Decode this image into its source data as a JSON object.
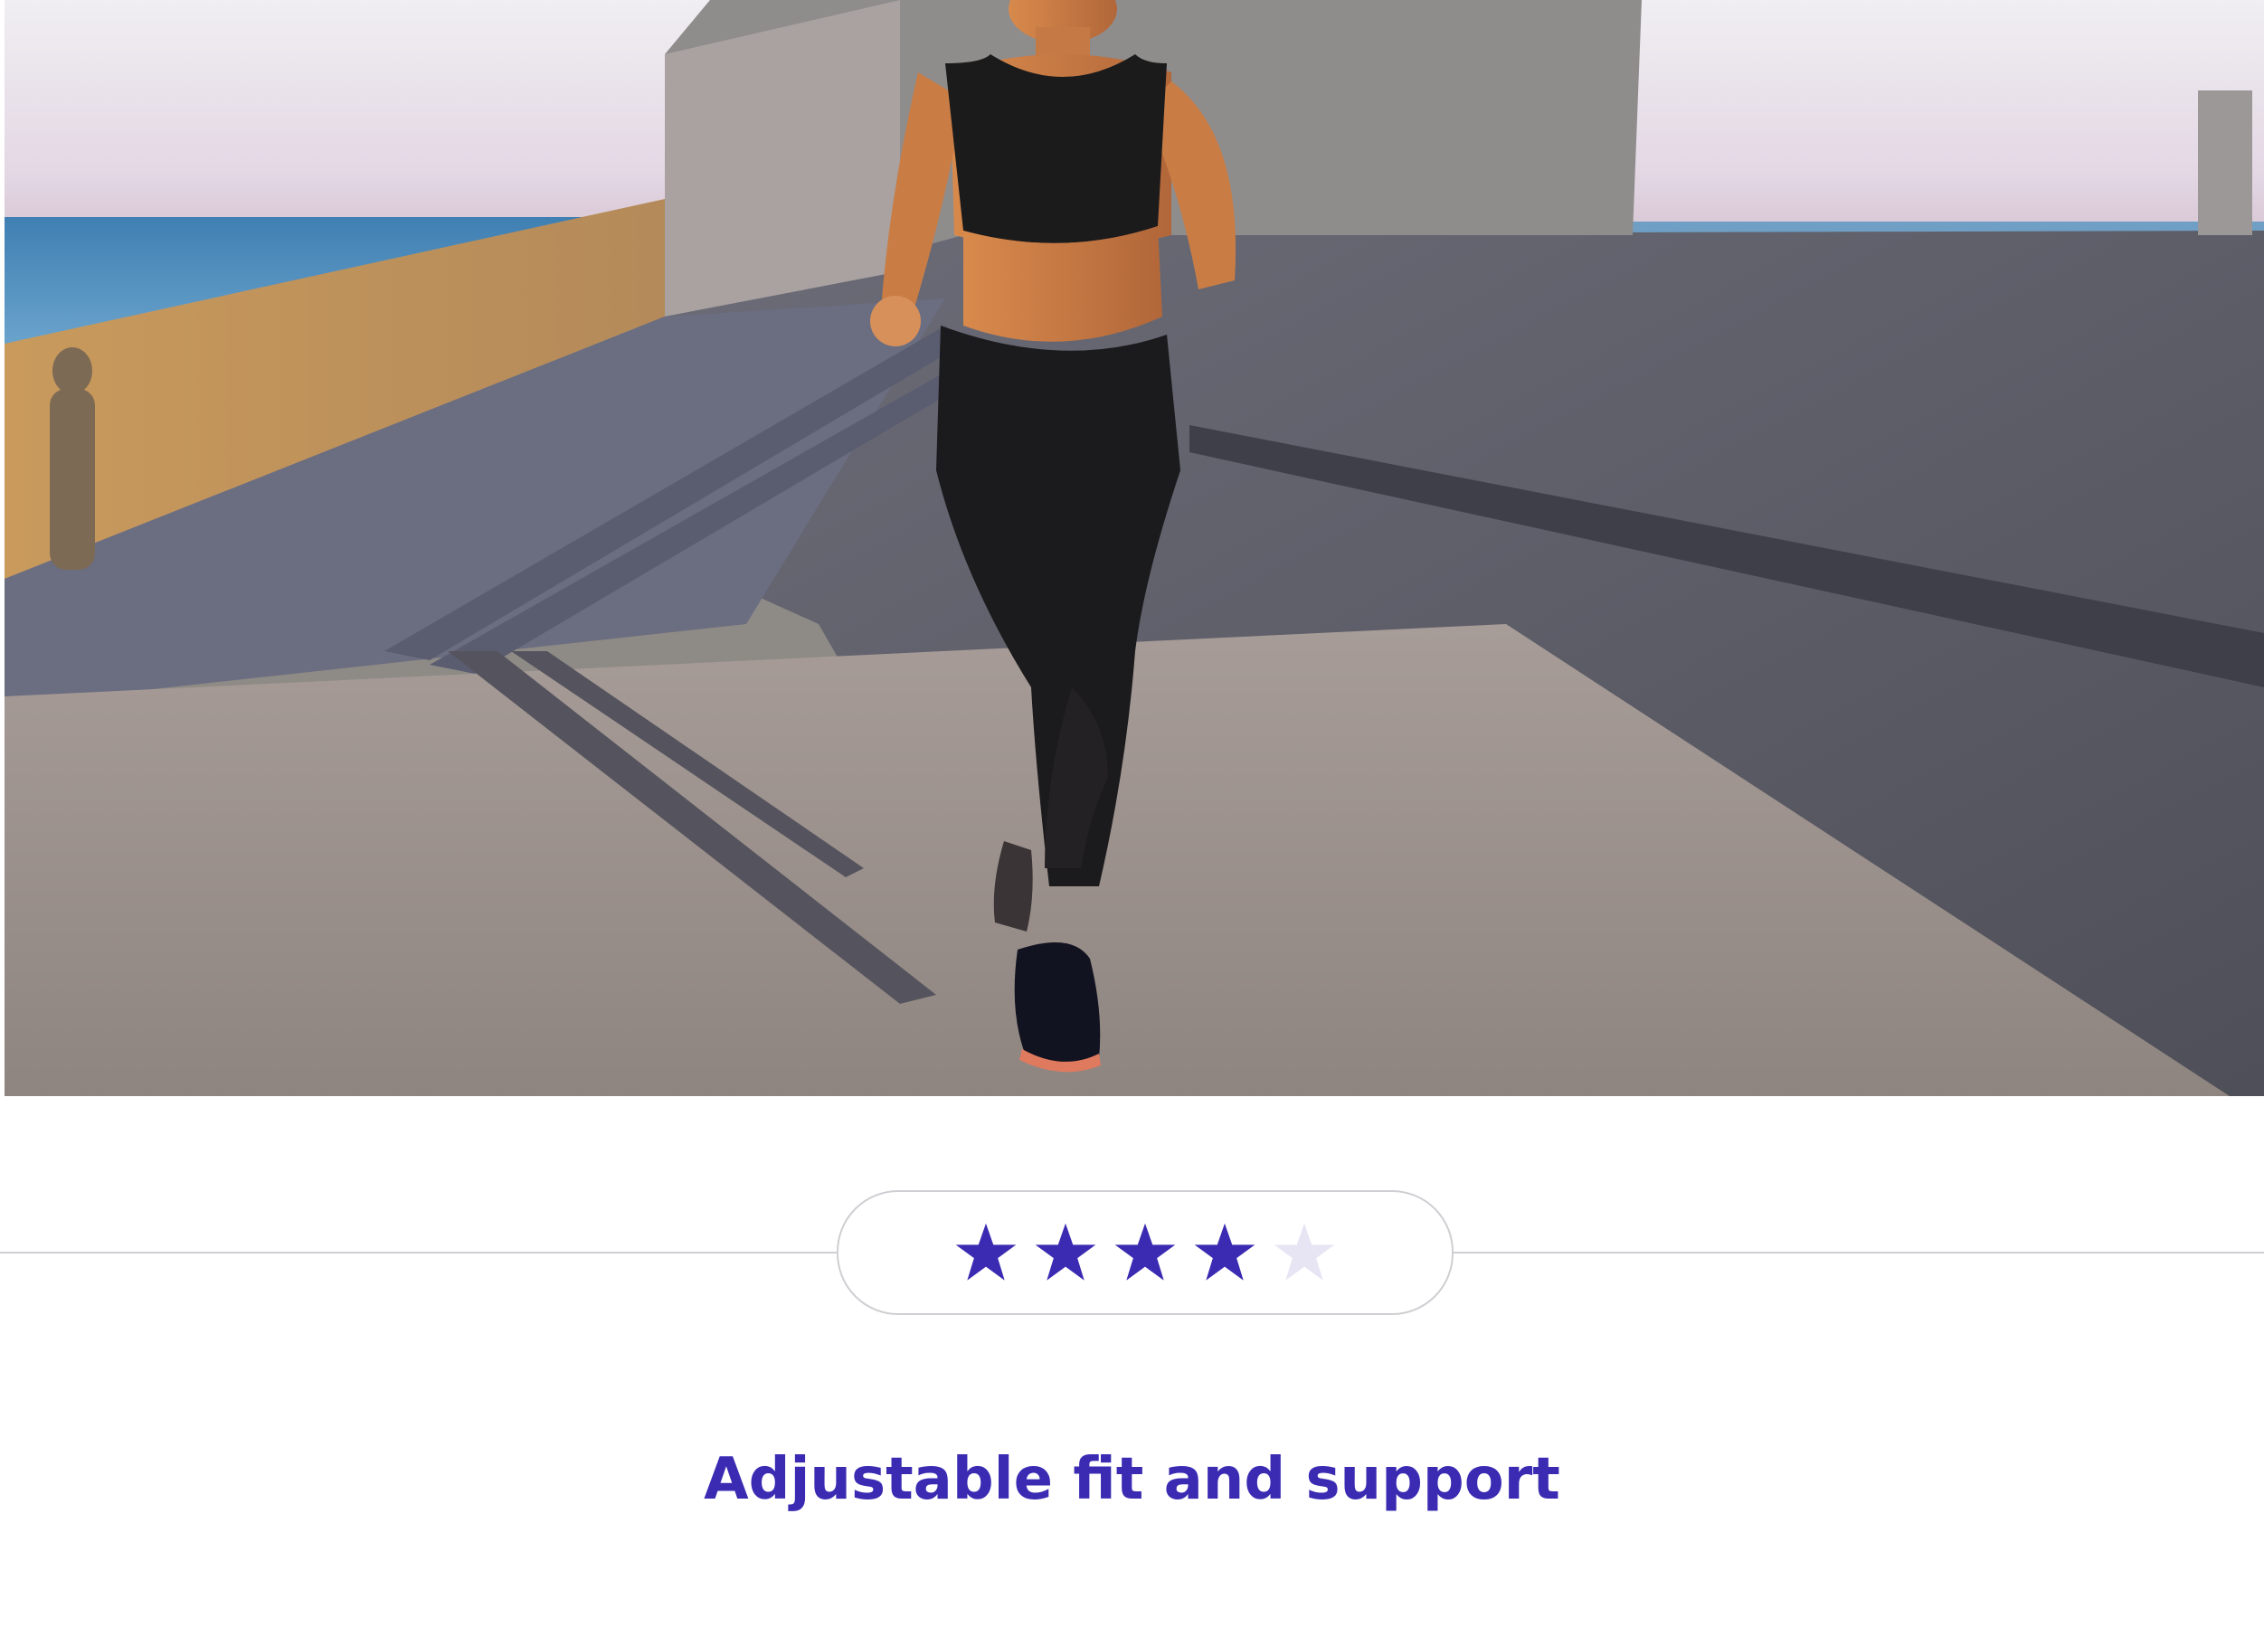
{
  "hero": {
    "image": "woman-running-on-concrete-promenade-photo"
  },
  "rating": {
    "value": 4,
    "max": 5,
    "filled_color": "#3a2bb2",
    "empty_color": "#e7e5f3",
    "icon": "star-icon"
  },
  "feature": {
    "headline": "Adjustable fit and support"
  },
  "colors": {
    "accent": "#3a2bb2",
    "divider": "#cfcfd3"
  }
}
